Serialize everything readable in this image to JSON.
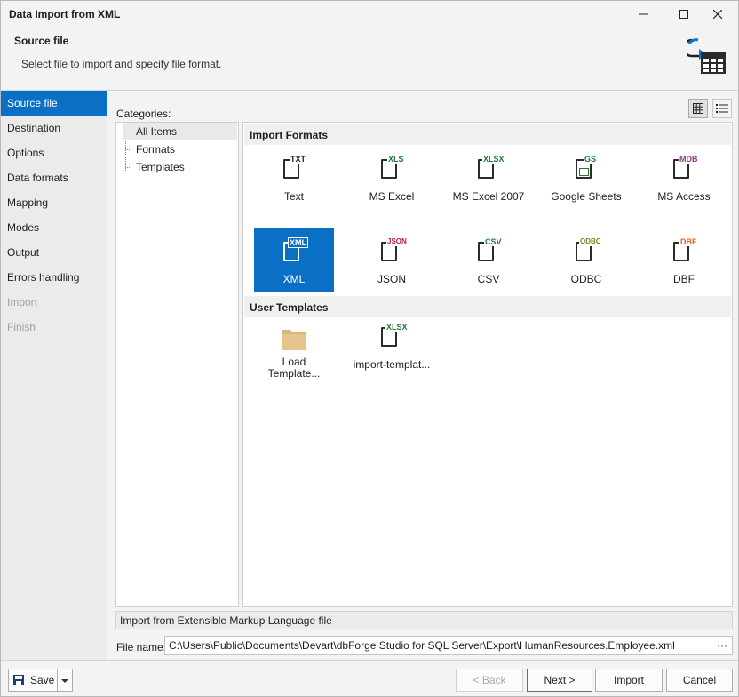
{
  "window": {
    "title": "Data Import from XML"
  },
  "header": {
    "title": "Source file",
    "subtitle": "Select file to import and specify file format."
  },
  "nav": {
    "items": [
      {
        "label": "Source file",
        "state": "active"
      },
      {
        "label": "Destination",
        "state": "normal"
      },
      {
        "label": "Options",
        "state": "normal"
      },
      {
        "label": "Data formats",
        "state": "normal"
      },
      {
        "label": "Mapping",
        "state": "normal"
      },
      {
        "label": "Modes",
        "state": "normal"
      },
      {
        "label": "Output",
        "state": "normal"
      },
      {
        "label": "Errors handling",
        "state": "normal"
      },
      {
        "label": "Import",
        "state": "disabled"
      },
      {
        "label": "Finish",
        "state": "disabled"
      }
    ]
  },
  "categories": {
    "label": "Categories:",
    "items": [
      "All Items",
      "Formats",
      "Templates"
    ],
    "selected": "All Items"
  },
  "formats": {
    "import_header": "Import Formats",
    "tiles": [
      {
        "label": "Text",
        "tag": "TXT",
        "tag_color": "#2b2b2b"
      },
      {
        "label": "MS Excel",
        "tag": "XLS",
        "tag_color": "#1e7b34"
      },
      {
        "label": "MS Excel 2007",
        "tag": "XLSX",
        "tag_color": "#1e7b34"
      },
      {
        "label": "Google Sheets",
        "tag": "GS",
        "tag_color": "#1e7b34"
      },
      {
        "label": "MS Access",
        "tag": "MDB",
        "tag_color": "#8e3a8e"
      },
      {
        "label": "XML",
        "tag": "XML",
        "tag_color": "#ffffff",
        "selected": true
      },
      {
        "label": "JSON",
        "tag": "JSON",
        "tag_color": "#b0223a"
      },
      {
        "label": "CSV",
        "tag": "CSV",
        "tag_color": "#1e7b34"
      },
      {
        "label": "ODBC",
        "tag": "ODBC",
        "tag_color": "#6d8b23"
      },
      {
        "label": "DBF",
        "tag": "DBF",
        "tag_color": "#e0611a"
      }
    ],
    "templates_header": "User Templates",
    "templates": [
      {
        "label": "Load Template...",
        "line1": "Load",
        "line2": "Template...",
        "icon": "folder-icon"
      },
      {
        "label": "import-templat...",
        "tag": "XLSX",
        "tag_color": "#1e7b34"
      }
    ]
  },
  "status_text": "Import from Extensible Markup Language file",
  "file_name": {
    "label": "File name:",
    "value": "C:\\Users\\Public\\Documents\\Devart\\dbForge Studio for SQL Server\\Export\\HumanResources.Employee.xml"
  },
  "footer": {
    "save": "Save",
    "back": "< Back",
    "next": "Next >",
    "import": "Import",
    "cancel": "Cancel"
  },
  "colors": {
    "accent": "#0a70c6",
    "nav_bg": "#ebebeb"
  }
}
